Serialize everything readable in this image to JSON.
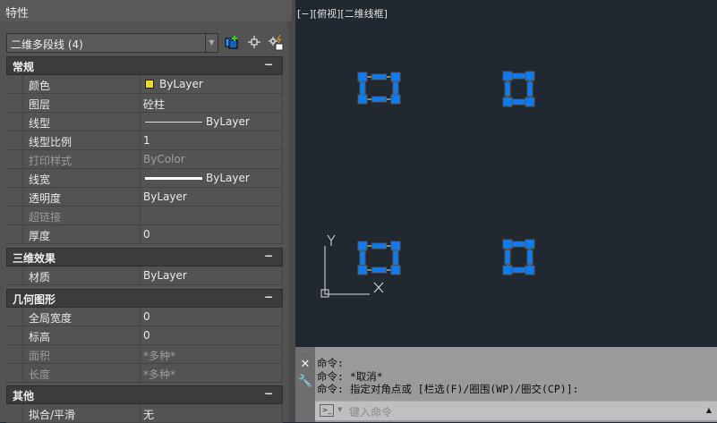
{
  "panel": {
    "title": "特性",
    "selector": "二维多段线 (4)"
  },
  "sections": [
    {
      "title": "常规",
      "rows": [
        {
          "k": "颜色",
          "v": "ByLayer"
        },
        {
          "k": "图层",
          "v": "砼柱"
        },
        {
          "k": "线型",
          "v": "ByLayer"
        },
        {
          "k": "线型比例",
          "v": "1"
        },
        {
          "k": "打印样式",
          "v": "ByColor"
        },
        {
          "k": "线宽",
          "v": "ByLayer"
        },
        {
          "k": "透明度",
          "v": "ByLayer"
        },
        {
          "k": "超链接",
          "v": ""
        },
        {
          "k": "厚度",
          "v": "0"
        }
      ]
    },
    {
      "title": "三维效果",
      "rows": [
        {
          "k": "材质",
          "v": "ByLayer"
        }
      ]
    },
    {
      "title": "几何图形",
      "rows": [
        {
          "k": "全局宽度",
          "v": "0"
        },
        {
          "k": "标高",
          "v": "0"
        },
        {
          "k": "面积",
          "v": "*多种*"
        },
        {
          "k": "长度",
          "v": "*多种*"
        }
      ]
    },
    {
      "title": "其他",
      "rows": [
        {
          "k": "拟合/平滑",
          "v": "无"
        }
      ]
    }
  ],
  "collapse": "−",
  "viewport": {
    "label": "[−][俯视][二维线框]",
    "ucs_x": "X",
    "ucs_y": "Y"
  },
  "command": {
    "history": [
      "命令:",
      "命令: *取消*",
      "命令: 指定对角点或 [栏选(F)/圈围(WP)/圈交(CP)]:"
    ],
    "placeholder": "键入命令"
  },
  "colors": {
    "grip": "#0a7cf5",
    "swatch": "#e8d82a"
  }
}
